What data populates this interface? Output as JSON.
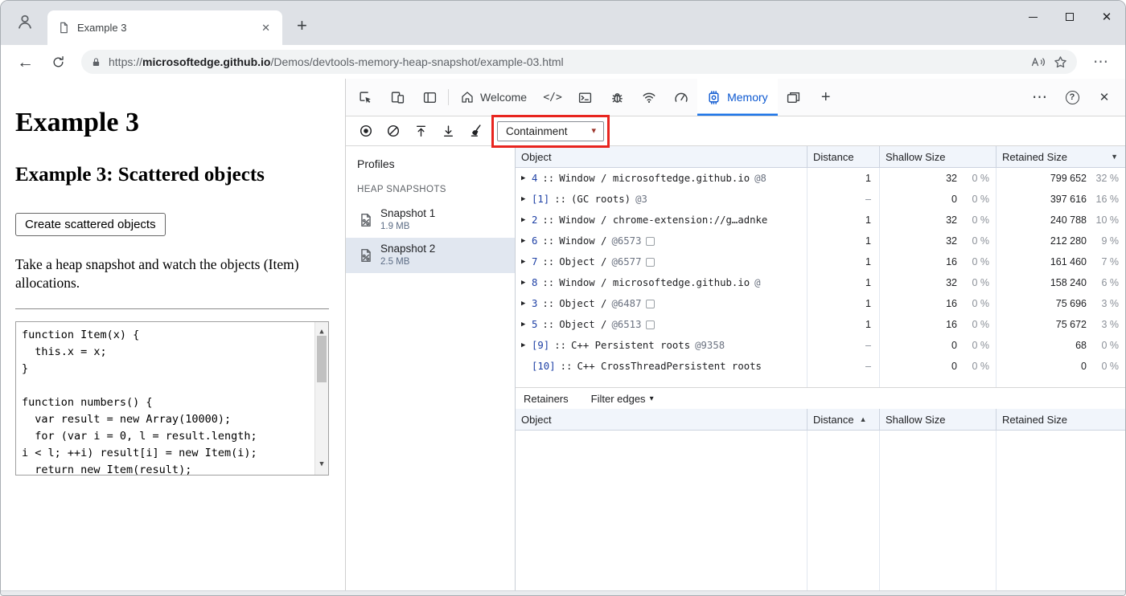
{
  "icons": {
    "close": "✕",
    "plus": "+",
    "back": "←",
    "more_h": "⋯",
    "help": "?",
    "expand": "▶",
    "sort_desc": "▼",
    "sort_asc": "▲",
    "caret_down": "▾",
    "scroll_up": "▲",
    "scroll_down": "▼"
  },
  "browser": {
    "tab_title": "Example 3",
    "url": {
      "scheme": "https://",
      "domain": "microsoftedge.github.io",
      "path": "/Demos/devtools-memory-heap-snapshot/example-03.html"
    }
  },
  "page": {
    "heading": "Example 3",
    "subheading": "Example 3: Scattered objects",
    "button_label": "Create scattered objects",
    "description": "Take a heap snapshot and watch the objects (Item) allocations.",
    "code_lines": [
      "function Item(x) {",
      "  this.x = x;",
      "}",
      "",
      "function numbers() {",
      "  var result = new Array(10000);",
      "  for (var i = 0, l = result.length;",
      "i < l; ++i) result[i] = new Item(i);",
      "  return new Item(result);"
    ]
  },
  "devtools": {
    "tab_welcome": "Welcome",
    "tab_memory": "Memory",
    "sources_glyph": "</>",
    "perspective": "Containment",
    "profiles": {
      "title": "Profiles",
      "section_title": "HEAP SNAPSHOTS",
      "snapshots": [
        {
          "name": "Snapshot 1",
          "size": "1.9 MB",
          "selected": false
        },
        {
          "name": "Snapshot 2",
          "size": "2.5 MB",
          "selected": true
        }
      ]
    },
    "heap_grid": {
      "separator": "::",
      "columns": {
        "object": "Object",
        "distance": "Distance",
        "shallow": "Shallow Size",
        "retained": "Retained Size"
      },
      "rows": [
        {
          "expand": true,
          "index": "4",
          "name": "Window / microsoftedge.github.io",
          "id": "@8",
          "box": false,
          "distance": "1",
          "shallow": "32",
          "shallow_pct": "0 %",
          "retained": "799 652",
          "retained_pct": "32 %"
        },
        {
          "expand": true,
          "index": "[1]",
          "name": "(GC roots)",
          "id": "@3",
          "box": false,
          "distance": "–",
          "shallow": "0",
          "shallow_pct": "0 %",
          "retained": "397 616",
          "retained_pct": "16 %"
        },
        {
          "expand": true,
          "index": "2",
          "name": "Window / chrome-extension://g…adnke",
          "id": "",
          "box": false,
          "distance": "1",
          "shallow": "32",
          "shallow_pct": "0 %",
          "retained": "240 788",
          "retained_pct": "10 %"
        },
        {
          "expand": true,
          "index": "6",
          "name": "Window /",
          "id": "@6573",
          "box": true,
          "distance": "1",
          "shallow": "32",
          "shallow_pct": "0 %",
          "retained": "212 280",
          "retained_pct": "9 %"
        },
        {
          "expand": true,
          "index": "7",
          "name": "Object /",
          "id": "@6577",
          "box": true,
          "distance": "1",
          "shallow": "16",
          "shallow_pct": "0 %",
          "retained": "161 460",
          "retained_pct": "7 %"
        },
        {
          "expand": true,
          "index": "8",
          "name": "Window / microsoftedge.github.io",
          "id": "@",
          "box": false,
          "distance": "1",
          "shallow": "32",
          "shallow_pct": "0 %",
          "retained": "158 240",
          "retained_pct": "6 %"
        },
        {
          "expand": true,
          "index": "3",
          "name": "Object /",
          "id": "@6487",
          "box": true,
          "distance": "1",
          "shallow": "16",
          "shallow_pct": "0 %",
          "retained": "75 696",
          "retained_pct": "3 %"
        },
        {
          "expand": true,
          "index": "5",
          "name": "Object /",
          "id": "@6513",
          "box": true,
          "distance": "1",
          "shallow": "16",
          "shallow_pct": "0 %",
          "retained": "75 672",
          "retained_pct": "3 %"
        },
        {
          "expand": true,
          "index": "[9]",
          "name": "C++ Persistent roots",
          "id": "@9358",
          "box": false,
          "distance": "–",
          "shallow": "0",
          "shallow_pct": "0 %",
          "retained": "68",
          "retained_pct": "0 %"
        },
        {
          "expand": false,
          "index": "[10]",
          "name": "C++ CrossThreadPersistent roots",
          "id": "",
          "box": false,
          "distance": "–",
          "shallow": "0",
          "shallow_pct": "0 %",
          "retained": "0",
          "retained_pct": "0 %"
        }
      ]
    },
    "retainers": {
      "title": "Retainers",
      "filter_label": "Filter edges",
      "columns": {
        "object": "Object",
        "distance": "Distance",
        "shallow": "Shallow Size",
        "retained": "Retained Size"
      }
    }
  }
}
